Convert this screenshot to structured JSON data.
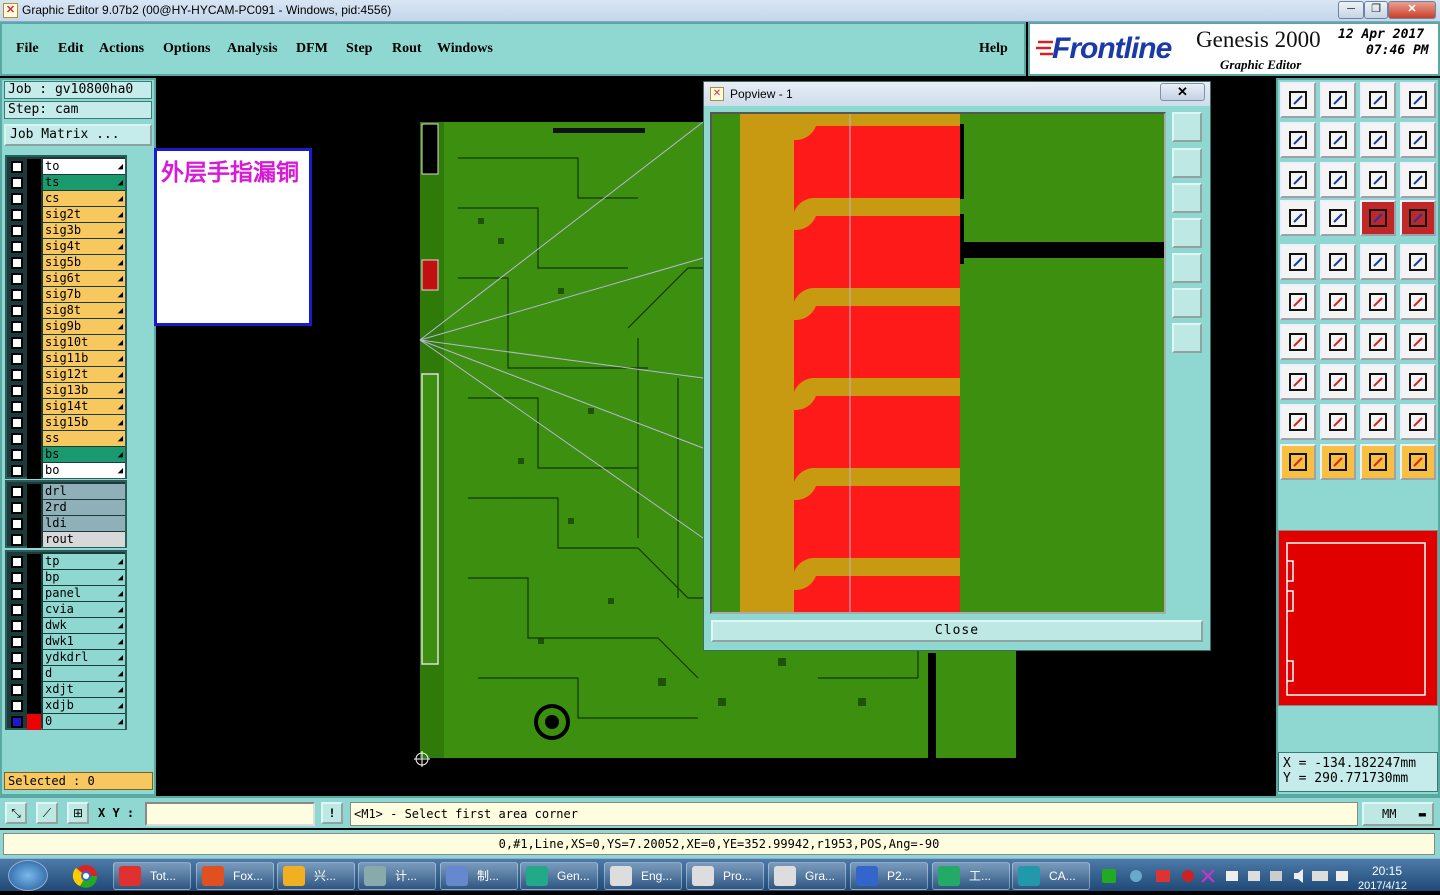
{
  "window": {
    "title": "Graphic Editor 9.07b2 (00@HY-HYCAM-PC091 - Windows, pid:4556)"
  },
  "menu": {
    "file": "File",
    "edit": "Edit",
    "actions": "Actions",
    "options": "Options",
    "analysis": "Analysis",
    "dfm": "DFM",
    "step": "Step",
    "rout": "Rout",
    "windows": "Windows",
    "help": "Help"
  },
  "brand": {
    "logo": "Frontline",
    "product": "Genesis 2000",
    "subtitle": "Graphic Editor",
    "date": "12 Apr 2017",
    "time": "07:46 PM"
  },
  "job": {
    "job_line": "Job : gv10800ha0",
    "step_line": "Step: cam",
    "matrix_button": "Job Matrix ..."
  },
  "layers_board": [
    {
      "name": "to",
      "color": "#ffffff"
    },
    {
      "name": "ts",
      "color": "#1a9a6e"
    },
    {
      "name": "cs",
      "color": "#f8c860"
    },
    {
      "name": "sig2t",
      "color": "#f8c860"
    },
    {
      "name": "sig3b",
      "color": "#f8c860"
    },
    {
      "name": "sig4t",
      "color": "#f8c860"
    },
    {
      "name": "sig5b",
      "color": "#f8c860"
    },
    {
      "name": "sig6t",
      "color": "#f8c860"
    },
    {
      "name": "sig7b",
      "color": "#f8c860"
    },
    {
      "name": "sig8t",
      "color": "#f8c860"
    },
    {
      "name": "sig9b",
      "color": "#f8c860"
    },
    {
      "name": "sig10t",
      "color": "#f8c860"
    },
    {
      "name": "sig11b",
      "color": "#f8c860"
    },
    {
      "name": "sig12t",
      "color": "#f8c860"
    },
    {
      "name": "sig13b",
      "color": "#f8c860"
    },
    {
      "name": "sig14t",
      "color": "#f8c860"
    },
    {
      "name": "sig15b",
      "color": "#f8c860"
    },
    {
      "name": "ss",
      "color": "#f8c860"
    },
    {
      "name": "bs",
      "color": "#1a9a6e"
    },
    {
      "name": "bo",
      "color": "#ffffff"
    }
  ],
  "layers_drill": [
    {
      "name": "drl",
      "color": "#8fb0b8"
    },
    {
      "name": "2rd",
      "color": "#8fb0b8"
    },
    {
      "name": "ldi",
      "color": "#8fb0b8"
    },
    {
      "name": "rout",
      "color": "#d8d8d8"
    }
  ],
  "layers_misc": [
    {
      "name": "tp",
      "color": "#8fd8d2"
    },
    {
      "name": "bp",
      "color": "#8fd8d2"
    },
    {
      "name": "panel",
      "color": "#8fd8d2"
    },
    {
      "name": "cvia",
      "color": "#8fd8d2"
    },
    {
      "name": "dwk",
      "color": "#8fd8d2"
    },
    {
      "name": "dwk1",
      "color": "#8fd8d2"
    },
    {
      "name": "ydkdrl",
      "color": "#8fd8d2"
    },
    {
      "name": "d",
      "color": "#8fd8d2"
    },
    {
      "name": "xdjt",
      "color": "#8fd8d2"
    },
    {
      "name": "xdjb",
      "color": "#8fd8d2"
    },
    {
      "name": "0",
      "color": "#8fd8d2"
    }
  ],
  "selected": "Selected : 0",
  "note": "外层手指漏铜",
  "popview": {
    "title": "Popview - 1",
    "close_x": "✕",
    "close_button": "Close"
  },
  "coords": {
    "x": "X = -134.182247mm",
    "y": "Y = 290.771730mm"
  },
  "cmd": {
    "xy_label": "X Y :",
    "xy_value": "",
    "prompt": "<M1> - Select first area corner",
    "unit": "MM"
  },
  "status_line": "0,#1,Line,XS=0,YS=7.20052,XE=0,YE=352.99942,r1953,POS,Ang=-90",
  "taskbar": {
    "items": [
      "Tot...",
      "Fox...",
      "兴...",
      "计...",
      "制...",
      "Gen...",
      "Eng...",
      "Pro...",
      "Gra...",
      "P2...",
      "工...",
      "CA..."
    ],
    "clock_time": "20:15",
    "clock_date": "2017/4/12"
  },
  "colors": {
    "panel": "#8fd8d2",
    "board": "#3d8f0f",
    "copper": "#c89a12",
    "finger": "#ff1a1a"
  }
}
